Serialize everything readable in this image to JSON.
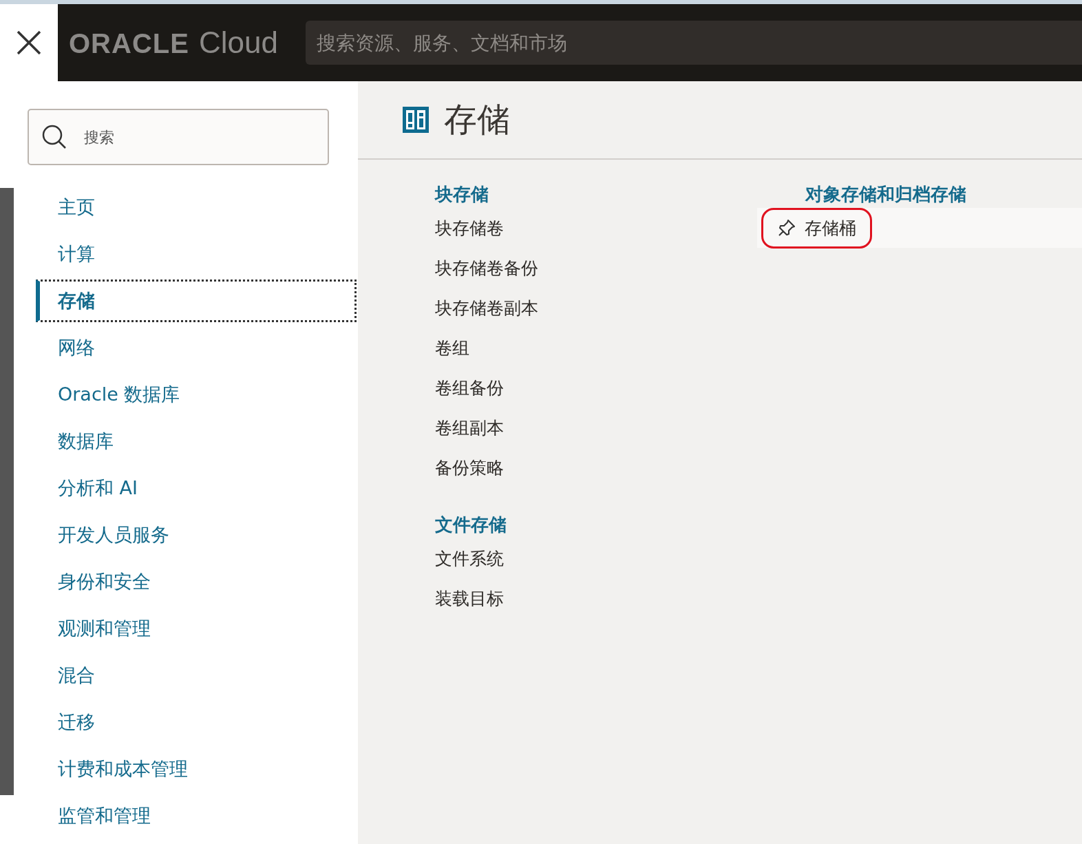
{
  "header": {
    "logo_wordmark": "ORACLE",
    "logo_product": "Cloud",
    "search": {
      "placeholder": "搜索资源、服务、文档和市场"
    }
  },
  "nav": {
    "search": {
      "placeholder": "搜索"
    },
    "items": [
      {
        "label": "主页",
        "selected": false
      },
      {
        "label": "计算",
        "selected": false
      },
      {
        "label": "存储",
        "selected": true
      },
      {
        "label": "网络",
        "selected": false
      },
      {
        "label": "Oracle 数据库",
        "selected": false
      },
      {
        "label": "数据库",
        "selected": false
      },
      {
        "label": "分析和 AI",
        "selected": false
      },
      {
        "label": "开发人员服务",
        "selected": false
      },
      {
        "label": "身份和安全",
        "selected": false
      },
      {
        "label": "观测和管理",
        "selected": false
      },
      {
        "label": "混合",
        "selected": false
      },
      {
        "label": "迁移",
        "selected": false
      },
      {
        "label": "计费和成本管理",
        "selected": false
      },
      {
        "label": "监管和管理",
        "selected": false
      }
    ]
  },
  "content": {
    "title": "存储",
    "columns": [
      {
        "sections": [
          {
            "heading": "块存储",
            "items": [
              {
                "label": "块存储卷",
                "hovered": false,
                "circled": false
              },
              {
                "label": "块存储卷备份",
                "hovered": false,
                "circled": false
              },
              {
                "label": "块存储卷副本",
                "hovered": false,
                "circled": false
              },
              {
                "label": "卷组",
                "hovered": false,
                "circled": false
              },
              {
                "label": "卷组备份",
                "hovered": false,
                "circled": false
              },
              {
                "label": "卷组副本",
                "hovered": false,
                "circled": false
              },
              {
                "label": "备份策略",
                "hovered": false,
                "circled": false
              }
            ]
          },
          {
            "heading": "文件存储",
            "items": [
              {
                "label": "文件系统",
                "hovered": false,
                "circled": false
              },
              {
                "label": "装载目标",
                "hovered": false,
                "circled": false
              }
            ]
          }
        ]
      },
      {
        "sections": [
          {
            "heading": "对象存储和归档存储",
            "items": [
              {
                "label": "存储桶",
                "hovered": true,
                "circled": true
              }
            ]
          }
        ]
      }
    ]
  }
}
